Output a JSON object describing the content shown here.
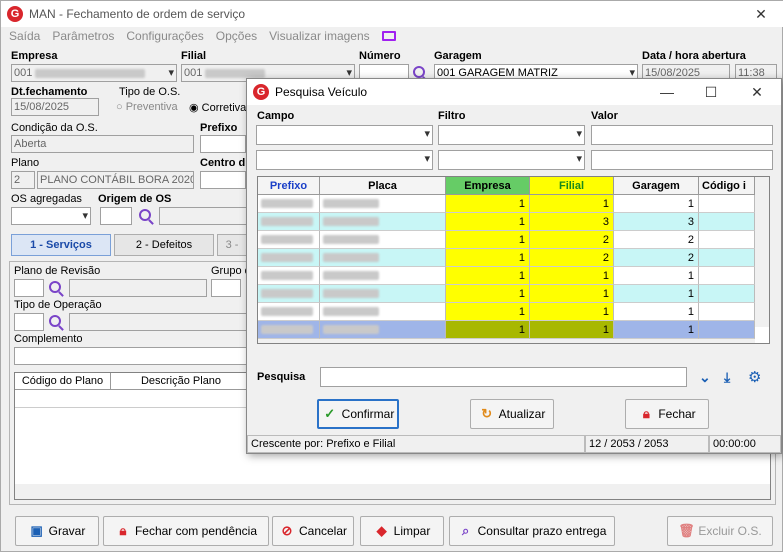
{
  "app": {
    "title": "MAN - Fechamento de ordem de serviço",
    "logo": "G"
  },
  "menu": [
    "Saída",
    "Parâmetros",
    "Configurações",
    "Opções",
    "Visualizar imagens"
  ],
  "form": {
    "empresa_label": "Empresa",
    "empresa_value": "001",
    "filial_label": "Filial",
    "filial_value": "001",
    "numero_label": "Número",
    "garagem_label": "Garagem",
    "garagem_value": "001 GARAGEM MATRIZ",
    "data_label": "Data / hora abertura",
    "data_value": "15/08/2025",
    "hora_value": "11:38",
    "dtfech_label": "Dt.fechamento",
    "dtfech_value": "15/08/2025",
    "tipo_os_label": "Tipo de O.S.",
    "preventiva": "Preventiva",
    "corretiva": "Corretiva",
    "condicao_label": "Condição da O.S.",
    "condicao_value": "Aberta",
    "prefixo_label": "Prefixo",
    "plano_label": "Plano",
    "plano_num": "2",
    "plano_value": "PLANO CONTÁBIL BORA 2020",
    "centro_label": "Centro d",
    "os_agregadas_label": "OS agregadas",
    "origem_label": "Origem de OS",
    "plano_revisao_label": "Plano de Revisão",
    "grupo_label": "Grupo d",
    "tipo_operacao_label": "Tipo de Operação",
    "complemento_label": "Complemento",
    "col_codigo": "Código do Plano",
    "col_descricao": "Descrição Plano"
  },
  "tabs": {
    "servicos": "1 - Serviços",
    "defeitos": "2 - Defeitos",
    "third": "3 -"
  },
  "bottom": {
    "gravar": "Gravar",
    "fechar_pend": "Fechar com pendência",
    "cancelar": "Cancelar",
    "limpar": "Limpar",
    "consultar": "Consultar prazo entrega",
    "excluir": "Excluir O.S."
  },
  "dialog": {
    "title": "Pesquisa Veículo",
    "campo": "Campo",
    "filtro": "Filtro",
    "valor": "Valor",
    "columns": [
      "Prefixo",
      "Placa",
      "Empresa",
      "Filial",
      "Garagem",
      "Código i"
    ],
    "rows": [
      {
        "empresa": "1",
        "filial": "1",
        "garagem": "1"
      },
      {
        "empresa": "1",
        "filial": "3",
        "garagem": "3"
      },
      {
        "empresa": "1",
        "filial": "2",
        "garagem": "2"
      },
      {
        "empresa": "1",
        "filial": "2",
        "garagem": "2"
      },
      {
        "empresa": "1",
        "filial": "1",
        "garagem": "1"
      },
      {
        "empresa": "1",
        "filial": "1",
        "garagem": "1"
      },
      {
        "empresa": "1",
        "filial": "1",
        "garagem": "1"
      },
      {
        "empresa": "1",
        "filial": "1",
        "garagem": "1"
      }
    ],
    "pesquisa_label": "Pesquisa",
    "confirmar": "Confirmar",
    "atualizar": "Atualizar",
    "fechar": "Fechar",
    "status_sort": "Crescente por: Prefixo e Filial",
    "status_count": "12 / 2053 / 2053",
    "status_time": "00:00:00"
  },
  "colors": {
    "accent": "#2a72c8",
    "yellow": "#ffff00",
    "cyan": "#c8f6f6",
    "selected": "#9fb5e8"
  }
}
